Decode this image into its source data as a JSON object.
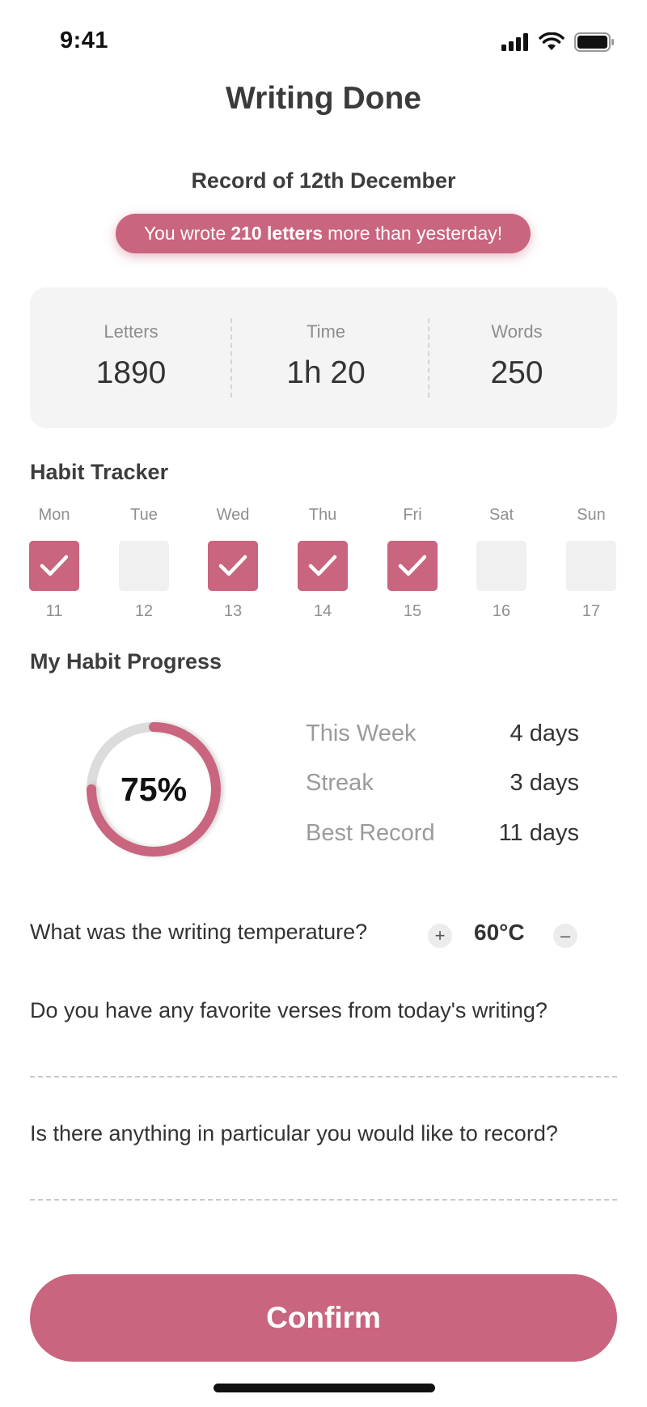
{
  "status_bar": {
    "time": "9:41",
    "icons": [
      "signal-icon",
      "wifi-icon",
      "battery-icon"
    ]
  },
  "page": {
    "title": "Writing Done"
  },
  "record": {
    "date_label": "Record of 12th December",
    "banner": {
      "prefix": "You wrote",
      "highlight": "210 letters",
      "suffix": "more than yesterday!"
    }
  },
  "stats": [
    {
      "label": "Letters",
      "value": "1890"
    },
    {
      "label": "Time",
      "value": "1h 20"
    },
    {
      "label": "Words",
      "value": "250"
    }
  ],
  "habit_tracker": {
    "title": "Habit Tracker",
    "days": [
      {
        "name": "Mon",
        "date": "11",
        "checked": true
      },
      {
        "name": "Tue",
        "date": "12",
        "checked": false
      },
      {
        "name": "Wed",
        "date": "13",
        "checked": true
      },
      {
        "name": "Thu",
        "date": "14",
        "checked": true
      },
      {
        "name": "Fri",
        "date": "15",
        "checked": true
      },
      {
        "name": "Sat",
        "date": "16",
        "checked": false
      },
      {
        "name": "Sun",
        "date": "17",
        "checked": false
      }
    ]
  },
  "habit_progress": {
    "title": "My Habit Progress",
    "percent_label": "75%",
    "percent": 0.75,
    "rows": [
      {
        "label": "This Week",
        "value": "4 days"
      },
      {
        "label": "Streak",
        "value": "3 days"
      },
      {
        "label": "Best Record",
        "value": "11 days"
      }
    ]
  },
  "temperature": {
    "question": "What was the writing temperature?",
    "value": "60°C",
    "plus": "+",
    "minus": "–"
  },
  "questions": {
    "verses": "Do you have any favorite verses from today's writing?",
    "record": "Is there anything in particular you would like to record?"
  },
  "confirm_label": "Confirm",
  "colors": {
    "accent": "#c9657e",
    "ring_track": "#dcdcdc",
    "card_bg": "#f4f4f4"
  }
}
